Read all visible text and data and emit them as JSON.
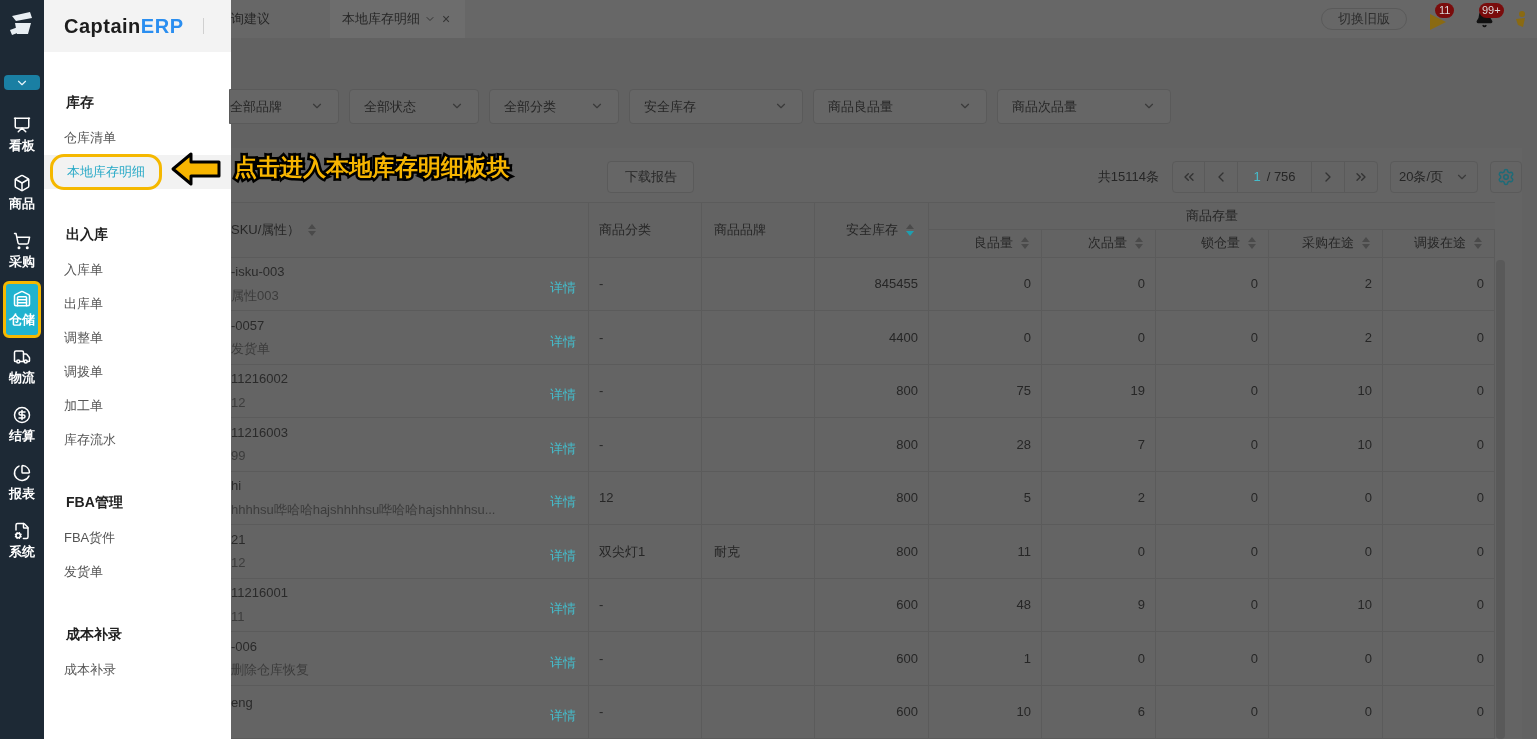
{
  "rail": {
    "items": [
      {
        "label": "看板",
        "selected": false
      },
      {
        "label": "商品",
        "selected": false
      },
      {
        "label": "采购",
        "selected": false
      },
      {
        "label": "仓储",
        "selected": true
      },
      {
        "label": "物流",
        "selected": false
      },
      {
        "label": "结算",
        "selected": false
      },
      {
        "label": "报表",
        "selected": false
      },
      {
        "label": "系统",
        "selected": false
      }
    ]
  },
  "menu": {
    "brand": {
      "name": "Captain",
      "accent": "ERP"
    },
    "sections": [
      {
        "title": "库存",
        "items": [
          {
            "label": "仓库清单",
            "selected": false
          },
          {
            "label": "本地库存明细",
            "selected": true
          }
        ]
      },
      {
        "title": "出入库",
        "items": [
          {
            "label": "入库单",
            "selected": false
          },
          {
            "label": "出库单",
            "selected": false
          },
          {
            "label": "调整单",
            "selected": false
          },
          {
            "label": "调拨单",
            "selected": false
          },
          {
            "label": "加工单",
            "selected": false
          },
          {
            "label": "库存流水",
            "selected": false
          }
        ]
      },
      {
        "title": "FBA管理",
        "items": [
          {
            "label": "FBA货件",
            "selected": false
          },
          {
            "label": "发货单",
            "selected": false
          }
        ]
      },
      {
        "title": "成本补录",
        "items": [
          {
            "label": "成本补录",
            "selected": false
          }
        ]
      }
    ]
  },
  "tabs": [
    {
      "label": "询建议",
      "selected": false
    },
    {
      "label": "本地库存明细",
      "selected": true,
      "close": "×"
    }
  ],
  "header": {
    "switch_button": "切换旧版",
    "flag_badge": "11",
    "bell_badge": "99+"
  },
  "filters": [
    "全部品牌",
    "全部状态",
    "全部分类",
    "安全库存",
    "商品良品量",
    "商品次品量"
  ],
  "toolbar": {
    "download_button": "下载报告",
    "total": "共15114条",
    "page": "1",
    "pages": "/ 756",
    "page_size": "20条/页"
  },
  "table": {
    "columns": [
      {
        "label": "SKU/属性）",
        "sorted": false
      },
      {
        "label": "商品分类"
      },
      {
        "label": "商品品牌"
      },
      {
        "label": "安全库存",
        "sorted": true
      }
    ],
    "group": "商品存量",
    "subcolumns": [
      {
        "label": "良品量",
        "sorted": false
      },
      {
        "label": "次品量",
        "sorted": false
      },
      {
        "label": "锁仓量",
        "sorted": false
      },
      {
        "label": "采购在途",
        "sorted": false
      },
      {
        "label": "调拨在途",
        "sorted": false
      }
    ],
    "rows": [
      {
        "sku": "-isku-003",
        "attr": "属性003",
        "link": "详情",
        "category": "-",
        "brand": "",
        "safety": "845455",
        "stock": [
          "0",
          "0",
          "0",
          "2",
          "0"
        ]
      },
      {
        "sku": "-0057",
        "attr": "发货单",
        "link": "详情",
        "category": "-",
        "brand": "",
        "safety": "4400",
        "stock": [
          "0",
          "0",
          "0",
          "2",
          "0"
        ]
      },
      {
        "sku": "11216002",
        "attr": "12",
        "link": "详情",
        "category": "-",
        "brand": "",
        "safety": "800",
        "stock": [
          "75",
          "19",
          "0",
          "10",
          "0"
        ]
      },
      {
        "sku": "11216003",
        "attr": "99",
        "link": "详情",
        "category": "-",
        "brand": "",
        "safety": "800",
        "stock": [
          "28",
          "7",
          "0",
          "10",
          "0"
        ]
      },
      {
        "sku": "hi",
        "attr": "hhhhsu哗哈哈hajshhhhsu哗哈哈hajshhhhsu...",
        "link": "详情",
        "category": "12",
        "brand": "",
        "safety": "800",
        "stock": [
          "5",
          "2",
          "0",
          "0",
          "0"
        ]
      },
      {
        "sku": "21",
        "attr": "12",
        "link": "详情",
        "category": "双尖灯1",
        "brand": "耐克",
        "safety": "800",
        "stock": [
          "11",
          "0",
          "0",
          "0",
          "0"
        ]
      },
      {
        "sku": "11216001",
        "attr": "11",
        "link": "详情",
        "category": "-",
        "brand": "",
        "safety": "600",
        "stock": [
          "48",
          "9",
          "0",
          "10",
          "0"
        ]
      },
      {
        "sku": "-006",
        "attr": "删除仓库恢复",
        "link": "详情",
        "category": "-",
        "brand": "",
        "safety": "600",
        "stock": [
          "1",
          "0",
          "0",
          "0",
          "0"
        ]
      },
      {
        "sku": "eng",
        "attr": "",
        "link": "详情",
        "category": "-",
        "brand": "",
        "safety": "600",
        "stock": [
          "10",
          "6",
          "0",
          "0",
          "0"
        ]
      }
    ]
  },
  "annotation": {
    "text": "点击进入本地库存明细板块"
  }
}
